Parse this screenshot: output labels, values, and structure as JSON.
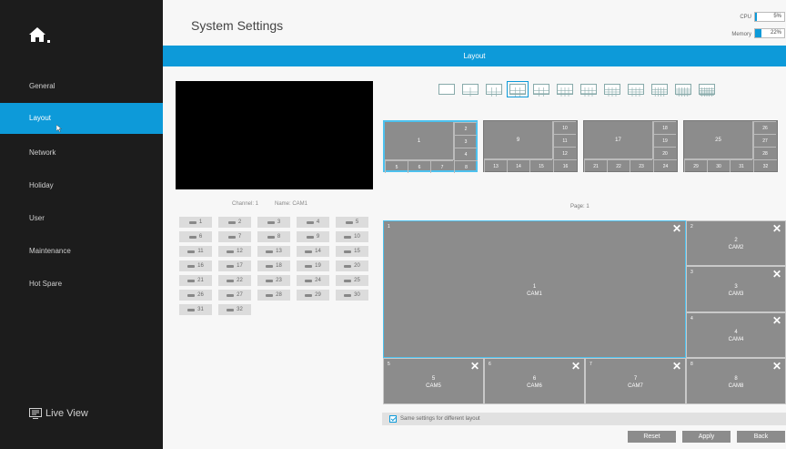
{
  "sidebar": {
    "items": [
      {
        "label": "General",
        "active": false
      },
      {
        "label": "Layout",
        "active": true
      },
      {
        "label": "Network",
        "active": false
      },
      {
        "label": "Holiday",
        "active": false
      },
      {
        "label": "User",
        "active": false
      },
      {
        "label": "Maintenance",
        "active": false
      },
      {
        "label": "Hot Spare",
        "active": false
      }
    ],
    "live_view": "Live View"
  },
  "header": {
    "title": "System Settings",
    "cpu": {
      "label": "CPU",
      "value": "5%",
      "percent": 5
    },
    "memory": {
      "label": "Memory",
      "value": "22%",
      "percent": 22
    }
  },
  "section_title": "Layout",
  "preview": {
    "channel_label": "Channel: 1",
    "name_label": "Name: CAM1"
  },
  "channels": [
    "1",
    "2",
    "3",
    "4",
    "5",
    "6",
    "7",
    "8",
    "9",
    "10",
    "11",
    "12",
    "13",
    "14",
    "15",
    "16",
    "17",
    "18",
    "19",
    "20",
    "21",
    "22",
    "23",
    "24",
    "25",
    "26",
    "27",
    "28",
    "29",
    "30",
    "31",
    "32"
  ],
  "layout_icons": [
    "layout-1",
    "layout-4",
    "layout-6",
    "layout-8",
    "layout-9a",
    "layout-9b",
    "layout-10",
    "layout-13",
    "layout-16a",
    "layout-16b",
    "layout-25",
    "layout-36"
  ],
  "selected_layout_index": 3,
  "thumbnails": [
    {
      "big": "1",
      "small": [
        "2",
        "3",
        "4",
        "5",
        "6",
        "7",
        "8"
      ],
      "selected": true
    },
    {
      "big": "9",
      "small": [
        "10",
        "11",
        "12",
        "13",
        "14",
        "15",
        "16"
      ],
      "selected": false
    },
    {
      "big": "17",
      "small": [
        "18",
        "19",
        "20",
        "21",
        "22",
        "23",
        "24"
      ],
      "selected": false
    },
    {
      "big": "25",
      "small": [
        "26",
        "27",
        "28",
        "29",
        "30",
        "31",
        "32"
      ],
      "selected": false
    }
  ],
  "page_label": "Page: 1",
  "layout_cells": [
    {
      "num": "1",
      "ch": "1",
      "cam": "CAM1"
    },
    {
      "num": "2",
      "ch": "2",
      "cam": "CAM2"
    },
    {
      "num": "3",
      "ch": "3",
      "cam": "CAM3"
    },
    {
      "num": "4",
      "ch": "4",
      "cam": "CAM4"
    },
    {
      "num": "5",
      "ch": "5",
      "cam": "CAM5"
    },
    {
      "num": "6",
      "ch": "6",
      "cam": "CAM6"
    },
    {
      "num": "7",
      "ch": "7",
      "cam": "CAM7"
    },
    {
      "num": "8",
      "ch": "8",
      "cam": "CAM8"
    }
  ],
  "close_glyph": "✕",
  "same_settings": {
    "label": "Same settings for different layout",
    "checked": true
  },
  "buttons": {
    "reset": "Reset",
    "apply": "Apply",
    "back": "Back"
  },
  "colors": {
    "accent": "#0d9ad9",
    "sidebar_bg": "#1c1c1c",
    "tile": "#8c8c8c"
  }
}
